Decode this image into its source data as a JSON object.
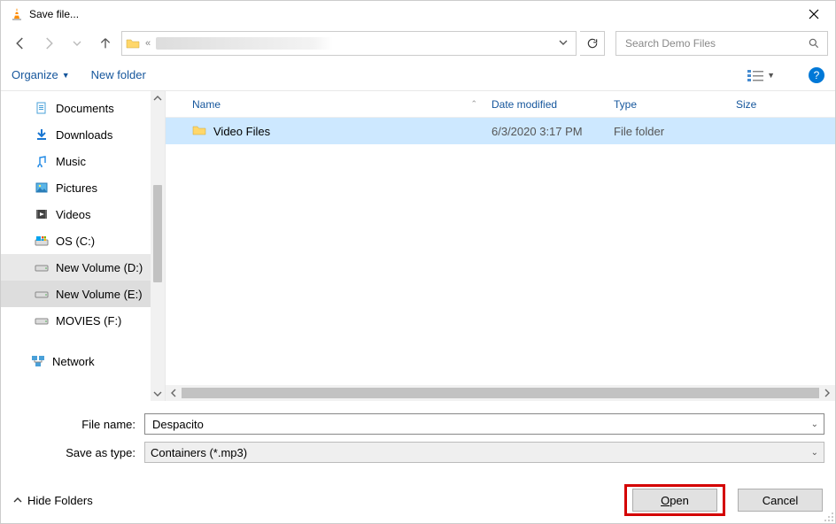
{
  "title": "Save file...",
  "nav": {
    "address_path": "",
    "search_placeholder": "Search Demo Files"
  },
  "toolbar": {
    "organize": "Organize",
    "new_folder": "New folder"
  },
  "tree": {
    "items": [
      {
        "label": "Documents",
        "icon": "document"
      },
      {
        "label": "Downloads",
        "icon": "download"
      },
      {
        "label": "Music",
        "icon": "music"
      },
      {
        "label": "Pictures",
        "icon": "pictures"
      },
      {
        "label": "Videos",
        "icon": "videos"
      },
      {
        "label": "OS (C:)",
        "icon": "osdrive"
      },
      {
        "label": "New Volume (D:)",
        "icon": "drive"
      },
      {
        "label": "New Volume (E:)",
        "icon": "drive",
        "selected": true
      },
      {
        "label": "MOVIES (F:)",
        "icon": "drive"
      }
    ],
    "network_label": "Network"
  },
  "columns": {
    "name": "Name",
    "date": "Date modified",
    "type": "Type",
    "size": "Size"
  },
  "files": [
    {
      "name": "Video Files",
      "date": "6/3/2020 3:17 PM",
      "type": "File folder",
      "size": "",
      "selected": true
    }
  ],
  "filename": {
    "label": "File name:",
    "value": "Despacito"
  },
  "savetype": {
    "label": "Save as type:",
    "value": "Containers (*.mp3)"
  },
  "bottom": {
    "hide_folders": "Hide Folders",
    "open": "Open",
    "cancel": "Cancel"
  }
}
